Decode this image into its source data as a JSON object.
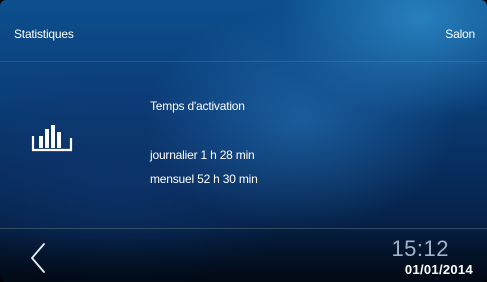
{
  "header": {
    "title": "Statistiques",
    "room": "Salon"
  },
  "content": {
    "icon": "bar-chart-icon",
    "title": "Temps d'activation",
    "daily": "journalier 1 h 28 min",
    "monthly": "mensuel 52 h 30 min"
  },
  "footer": {
    "back_icon": "chevron-left-icon",
    "time": "15:12",
    "date": "01/01/2014"
  },
  "colors": {
    "background_top": "#0d4f8e",
    "background_bottom": "#03142d",
    "time_color": "#9fb3c8",
    "text": "#ffffff"
  }
}
